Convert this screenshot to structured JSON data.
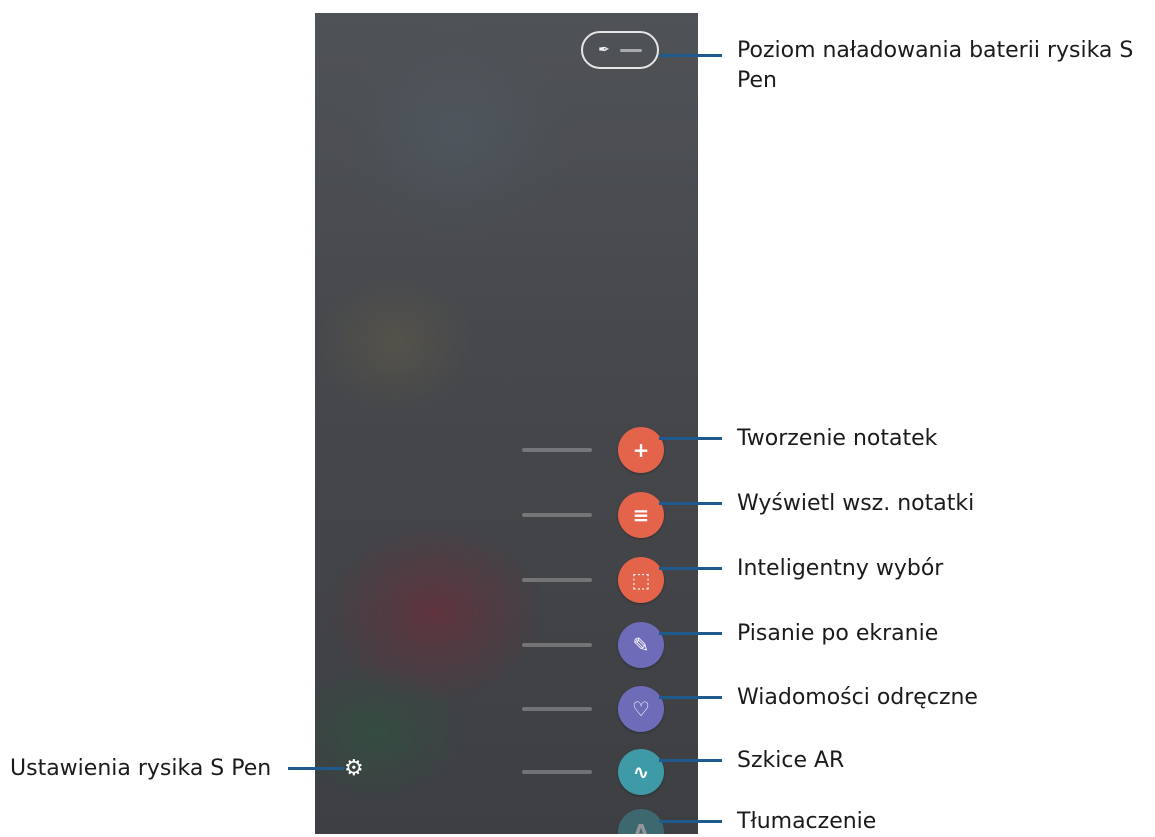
{
  "device": {
    "pen_glyph": "✒",
    "actions": [
      {
        "key": "create-note",
        "icon": "+",
        "color": "#e3644a"
      },
      {
        "key": "view-all-notes",
        "icon": "≡",
        "color": "#e3644a"
      },
      {
        "key": "smart-select",
        "icon": "⬚",
        "color": "#e3644a"
      },
      {
        "key": "screen-write",
        "icon": "✎",
        "color": "#6e6cb8"
      },
      {
        "key": "live-messages",
        "icon": "♡",
        "color": "#6e6cb8"
      },
      {
        "key": "ar-doodle",
        "icon": "∿",
        "color": "#3e9aa6"
      },
      {
        "key": "translate",
        "icon": "A",
        "color": "#3e9aa6"
      }
    ],
    "settings_icon": "⚙"
  },
  "callouts": {
    "battery": "Poziom naładowania baterii rysika S Pen",
    "create_note": "Tworzenie notatek",
    "view_all_notes": "Wyświetl wsz. notatki",
    "smart_select": "Inteligentny wybór",
    "screen_write": "Pisanie po ekranie",
    "live_messages": "Wiadomości odręczne",
    "ar_doodle": "Szkice AR",
    "translate": "Tłumaczenie",
    "settings": "Ustawienia rysika S Pen"
  }
}
